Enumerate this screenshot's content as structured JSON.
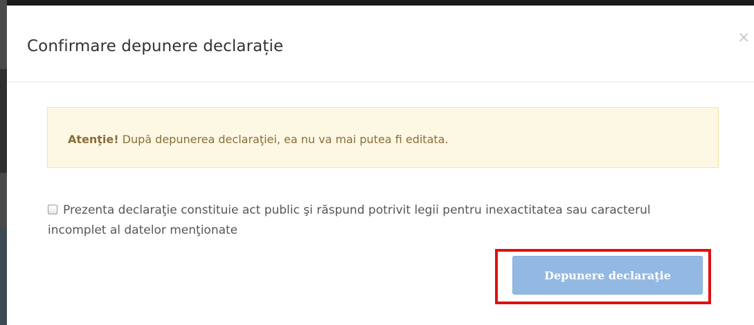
{
  "modal": {
    "title": "Confirmare depunere declarație",
    "close_label": "×"
  },
  "alert": {
    "strong": "Atenţie!",
    "message": " După depunerea declaraţiei, ea nu va mai putea fi editata."
  },
  "checkbox": {
    "checked": false,
    "label": "Prezenta declaraţie constituie act public şi răspund potrivit legii pentru inexactitatea sau caracterul incomplet al datelor menţionate"
  },
  "submit": {
    "label": "Depunere declaraţie",
    "disabled": true
  },
  "colors": {
    "alert_background": "#fcf8e3",
    "alert_text": "#8a6d3b",
    "button_disabled": "#93b9e2",
    "highlight": "#e01010"
  }
}
